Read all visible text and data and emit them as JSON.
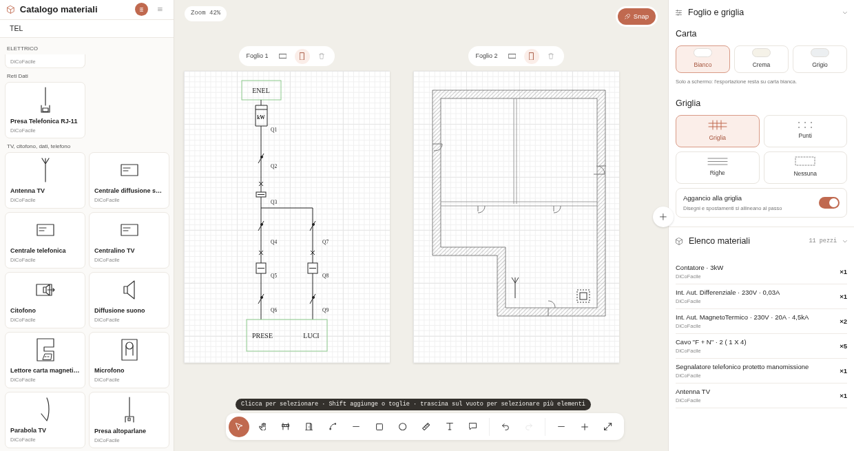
{
  "sidebar": {
    "title": "Catalogo materiali",
    "search": {
      "value": "TEL"
    },
    "view_buttons": [
      {
        "kind": "grid",
        "selected": true
      },
      {
        "kind": "list",
        "selected": false
      }
    ],
    "sections": [
      {
        "title": "ELETTRICO",
        "items": [
          {
            "source": "DiCoFacile"
          }
        ]
      },
      {
        "title": "Reti Dati",
        "items": [
          {
            "name": "Presa Telefonica RJ-11",
            "source": "DiCoFacile",
            "kind": "rj11"
          }
        ]
      },
      {
        "title": "TV, citofono, dati, telefono",
        "items": [
          {
            "name": "Antenna TV",
            "source": "DiCoFacile",
            "kind": "antenna"
          },
          {
            "name": "Centrale diffusione s…",
            "source": "DiCoFacile",
            "kind": "central"
          },
          {
            "name": "Centrale telefonica",
            "source": "DiCoFacile",
            "kind": "central"
          },
          {
            "name": "Centralino TV",
            "source": "DiCoFacile",
            "kind": "central"
          },
          {
            "name": "Citofono",
            "source": "DiCoFacile",
            "kind": "intercom"
          },
          {
            "name": "Diffusione suono",
            "source": "DiCoFacile",
            "kind": "speaker"
          },
          {
            "name": "Lettore carta magneti…",
            "source": "DiCoFacile",
            "kind": "card_reader"
          },
          {
            "name": "Microfono",
            "source": "DiCoFacile",
            "kind": "microphone"
          },
          {
            "name": "Parabola TV",
            "source": "DiCoFacile",
            "kind": "dish"
          },
          {
            "name": "Presa altoparlane",
            "source": "DiCoFacile",
            "kind": "speaker_socket"
          }
        ]
      }
    ]
  },
  "canvas": {
    "zoom_label": "Zoom 42%",
    "snap_button": {
      "label": "Snap",
      "on": true
    },
    "sheets": [
      {
        "label": "Foglio 1",
        "orientations": [
          {
            "kind": "landscape",
            "selected": false
          },
          {
            "kind": "portrait",
            "selected": true
          }
        ],
        "kind": "schematic",
        "schematic": {
          "supply": "ENEL",
          "meter_label": "kW",
          "breakers": [
            "Q1",
            "Q2",
            "Q3",
            "Q4",
            "Q5",
            "Q6",
            "Q7",
            "Q8",
            "Q9"
          ],
          "loads": [
            "PRESE",
            "LUCI"
          ]
        }
      },
      {
        "label": "Foglio 2",
        "orientations": [
          {
            "kind": "landscape",
            "selected": false
          },
          {
            "kind": "portrait",
            "selected": true
          }
        ],
        "kind": "floorplan"
      }
    ],
    "hint": "Clicca per selezionare · Shift aggiunge o toglie · trascina sul vuoto per selezionare più elementi",
    "tool_groups": [
      [
        {
          "kind": "select",
          "selected": true,
          "disabled": false
        },
        {
          "kind": "hand",
          "selected": false,
          "disabled": false
        },
        {
          "kind": "barrier",
          "selected": false,
          "disabled": false
        },
        {
          "kind": "door",
          "selected": false,
          "disabled": false
        },
        {
          "kind": "curve",
          "selected": false,
          "disabled": false
        },
        {
          "kind": "line",
          "selected": false,
          "disabled": false
        },
        {
          "kind": "rect",
          "selected": false,
          "disabled": false
        },
        {
          "kind": "circle",
          "selected": false,
          "disabled": false
        },
        {
          "kind": "ruler",
          "selected": false,
          "disabled": false
        },
        {
          "kind": "text",
          "selected": false,
          "disabled": false
        },
        {
          "kind": "comment",
          "selected": false,
          "disabled": false
        }
      ],
      [
        {
          "kind": "undo",
          "selected": false,
          "disabled": false
        },
        {
          "kind": "redo",
          "selected": false,
          "disabled": true
        }
      ],
      [
        {
          "kind": "zoom_out",
          "selected": false,
          "disabled": false
        },
        {
          "kind": "zoom_in",
          "selected": false,
          "disabled": false
        },
        {
          "kind": "fit",
          "selected": false,
          "disabled": false
        }
      ]
    ]
  },
  "sheet_settings": {
    "title": "Foglio e griglia",
    "expanded": true,
    "paper_label": "Carta",
    "papers": [
      {
        "label": "Bianco",
        "color": "#ffffff",
        "selected": true
      },
      {
        "label": "Crema",
        "color": "#f5f2e8",
        "selected": false
      },
      {
        "label": "Grigio",
        "color": "#eceff1",
        "selected": false
      }
    ],
    "paper_note": "Solo a schermo: l'esportazione resta su carta bianca.",
    "grid_label": "Griglia",
    "grid_styles": [
      {
        "label": "Griglia",
        "kind": "lines",
        "selected": true
      },
      {
        "label": "Punti",
        "kind": "dots",
        "selected": false
      },
      {
        "label": "Righe",
        "kind": "rows",
        "selected": false
      },
      {
        "label": "Nessuna",
        "kind": "none",
        "selected": false
      }
    ],
    "snap": {
      "title": "Aggancio alla griglia",
      "description": "Disegni e spostamenti si allineano al passo",
      "on": true
    }
  },
  "materials": {
    "title": "Elenco materiali",
    "count": "11 pezzi",
    "expanded": true,
    "items": [
      {
        "name": "Contatore · 3kW",
        "source": "DiCoFacile",
        "quantity": "×1"
      },
      {
        "name": "Int. Aut. Differenziale · 230V · 0,03A",
        "source": "DiCoFacile",
        "quantity": "×1"
      },
      {
        "name": "Int. Aut. MagnetoTermico · 230V · 20A · 4,5kA",
        "source": "DiCoFacile",
        "quantity": "×2"
      },
      {
        "name": "Cavo \"F + N\" · 2 ( 1 X 4)",
        "source": "DiCoFacile",
        "quantity": "×5"
      },
      {
        "name": "Segnalatore telefonico protetto manomissione",
        "source": "DiCoFacile",
        "quantity": "×1"
      },
      {
        "name": "Antenna TV",
        "source": "DiCoFacile",
        "quantity": "×1"
      }
    ]
  }
}
